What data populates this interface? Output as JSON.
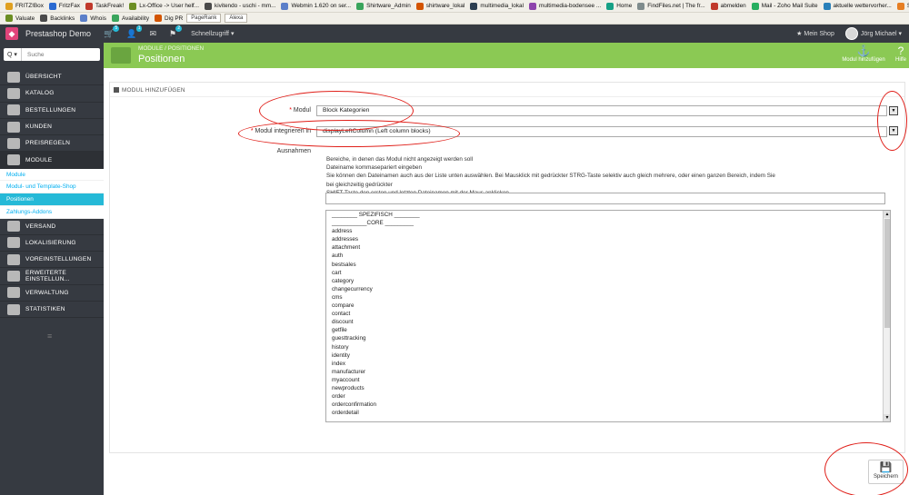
{
  "bookmarks_row1": [
    "FRITZ!Box",
    "FritzFax",
    "TaskFreak!",
    "Lx-Office -> User helf...",
    "kivitendo - uschi - mm...",
    "Webmin 1.620 on ser...",
    "Shirtware_Admin",
    "shirtware_lokal",
    "multimedia_lokal",
    "multimedia-bodensee ...",
    "Home",
    "FindFiles.net | The fr...",
    "abmelden",
    "Mail - Zoho Mail Suite",
    "aktuelle wettervorher...",
    "Shirtware - Textildruck"
  ],
  "bookmarks_row2": [
    "Valuate",
    "Backlinks",
    "Whois",
    "Availability",
    "Dig PR",
    "PageRank",
    "Alexa"
  ],
  "topbar": {
    "shop_name": "Prestashop Demo",
    "badges": [
      "5",
      "1",
      "2"
    ],
    "quick_access": "Schnellzugriff ▾",
    "my_shop": "★ Mein Shop",
    "user_name": "Jörg Michael ▾"
  },
  "search": {
    "button": "Q ▾",
    "placeholder": "Suche"
  },
  "nav": {
    "items_top": [
      "ÜBERSICHT",
      "KATALOG",
      "BESTELLUNGEN",
      "KUNDEN",
      "PREISREGELN",
      "MODULE"
    ],
    "sub_items": [
      "Module",
      "Modul- und Template-Shop",
      "Positionen",
      "Zahlungs-Addons"
    ],
    "items_bottom": [
      "VERSAND",
      "LOKALISIERUNG",
      "VOREINSTELLUNGEN",
      "ERWEITERTE EINSTELLUN...",
      "VERWALTUNG",
      "STATISTIKEN"
    ],
    "collapse_glyph": "≡"
  },
  "page": {
    "breadcrumb": "MODULE  /  POSITIONEN",
    "title": "Positionen",
    "add_module": "Modul hinzufügen",
    "help": "Hilfe"
  },
  "form": {
    "heading": "MODUL HINZUFÜGEN",
    "module_label": "Modul",
    "module_value": "Block Kategorien",
    "hook_label": "Modul integrieren in",
    "hook_value": "displayLeftColumn (Left column blocks)",
    "exceptions_label": "Ausnahmen",
    "help_lines": [
      "Bereiche, in denen das Modul nicht angezeigt werden soll",
      "Dateiname kommasepariert eingeben",
      "Sie können den Dateinamen auch aus der Liste unten auswählen. Bei Mausklick mit gedrückter STRG-Taste selektiv auch gleich mehrere, oder einen ganzen Bereich, indem Sie bei gleichzeitig gedrückter",
      "SHIFT-Taste den ersten und letzten Dateinamen mit der Maus anklicken."
    ],
    "exceptions_input": "",
    "list_items": [
      "________ SPEZIFISCH ________",
      "___________CORE _________",
      "address",
      "addresses",
      "attachment",
      "auth",
      "bestsales",
      "cart",
      "category",
      "changecurrency",
      "cms",
      "compare",
      "contact",
      "discount",
      "getfile",
      "guesttracking",
      "history",
      "identity",
      "index",
      "manufacturer",
      "myaccount",
      "newproducts",
      "order",
      "orderconfirmation",
      "orderdetail"
    ],
    "save": "Speichern"
  }
}
